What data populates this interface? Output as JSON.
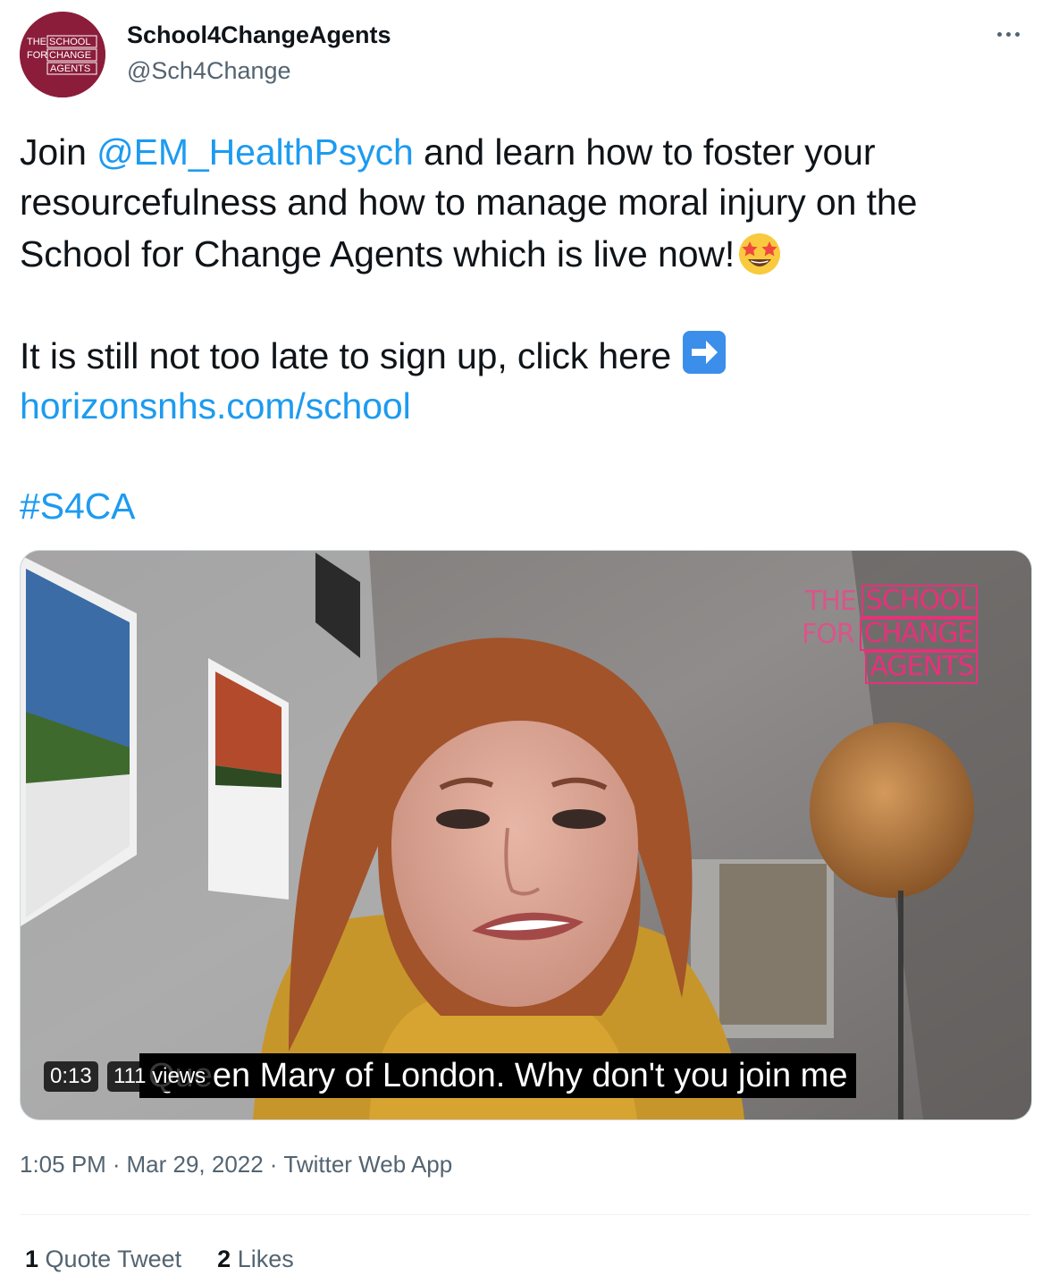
{
  "author": {
    "display_name": "School4ChangeAgents",
    "handle": "@Sch4Change",
    "avatar_logo": {
      "line1_plain": "THE",
      "line1_boxed": "SCHOOL",
      "line2_plain": "FOR",
      "line2_boxed": "CHANGE",
      "line3_boxed": "AGENTS"
    },
    "avatar_color": "#8b1d3a"
  },
  "tweet": {
    "intro": "Join ",
    "mention": "@EM_HealthPsych",
    "body": " and learn how to foster your resourcefulness and how to manage moral injury on the School for Change Agents which is live now!",
    "emoji_star": "star-struck-emoji",
    "signup_text": "It is still not too late to sign up, click here ",
    "emoji_arrow": "right-arrow-emoji",
    "url": "horizonsnhs.com/school",
    "hashtag": "#S4CA"
  },
  "video": {
    "logo": {
      "line1_plain": "THE",
      "line1_boxed": "SCHOOL",
      "line2_plain": "FOR",
      "line2_boxed": "CHANGE",
      "line3_boxed": "AGENTS"
    },
    "subtitle": "Queen Mary of London. Why don't you join me",
    "duration": "0:13",
    "views": "111 views"
  },
  "meta": {
    "time": "1:05 PM",
    "date": "Mar 29, 2022",
    "source": "Twitter Web App",
    "separator": "·"
  },
  "stats": {
    "quote_count": "1",
    "quote_label": "Quote Tweet",
    "likes_count": "2",
    "likes_label": "Likes"
  },
  "colors": {
    "link": "#1d9bf0",
    "secondary_text": "#536471",
    "logo_pink": "#e8307a"
  }
}
